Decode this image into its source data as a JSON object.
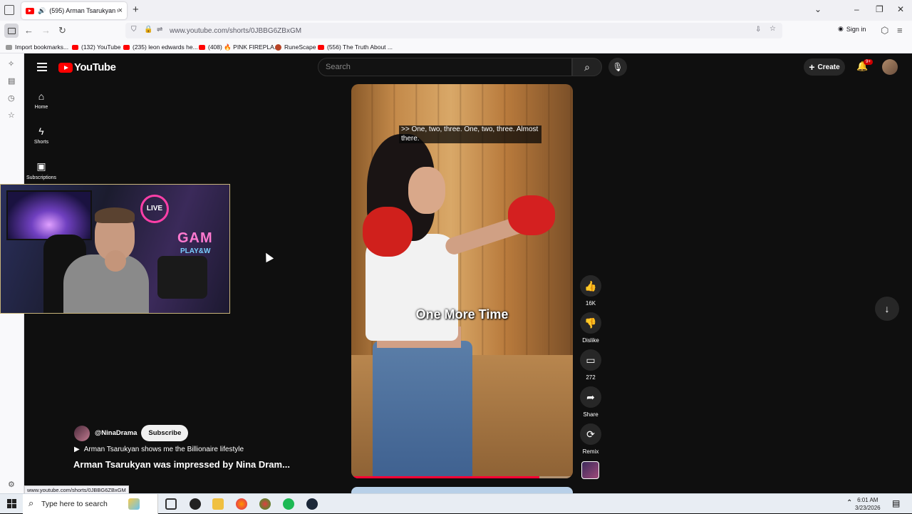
{
  "browser": {
    "tab_title": "(595) Arman Tsarukyan was i",
    "url": "www.youtube.com/shorts/0JBBG6ZBxGM",
    "sign_in": "Sign in",
    "status_url": "www.youtube.com/shorts/0JBBG6ZBxGM",
    "bookmarks": [
      "Import bookmarks...",
      "(132) YouTube",
      "(235) leon edwards he...",
      "(408) 🔥 PINK FIREPLA...",
      "RuneScape",
      "(556) The Truth About ..."
    ]
  },
  "youtube": {
    "logo": "YouTube",
    "search_placeholder": "Search",
    "create_label": "Create",
    "notif_badge": "9+",
    "nav": [
      {
        "label": "Home"
      },
      {
        "label": "Shorts"
      },
      {
        "label": "Subscriptions"
      }
    ]
  },
  "short": {
    "caption": ">> One, two, three. One, two, three. Almost there.",
    "overlay": "One More Time",
    "progress": 0.85,
    "channel": "@NinaDrama",
    "subscribe": "Subscribe",
    "song": "Arman Tsarukyan shows me the Billionaire lifestyle",
    "title": "Arman Tsarukyan was impressed by Nina Dram...",
    "actions": {
      "likes": "16K",
      "dislike": "Dislike",
      "comments": "272",
      "share": "Share",
      "remix": "Remix"
    }
  },
  "webcam": {
    "sign1": "LIVE",
    "sign2": "GAM",
    "sign3": "PLAY&W"
  },
  "taskbar": {
    "search": "Type here to search",
    "time": "6:01 AM",
    "date": "3/23/2026"
  }
}
